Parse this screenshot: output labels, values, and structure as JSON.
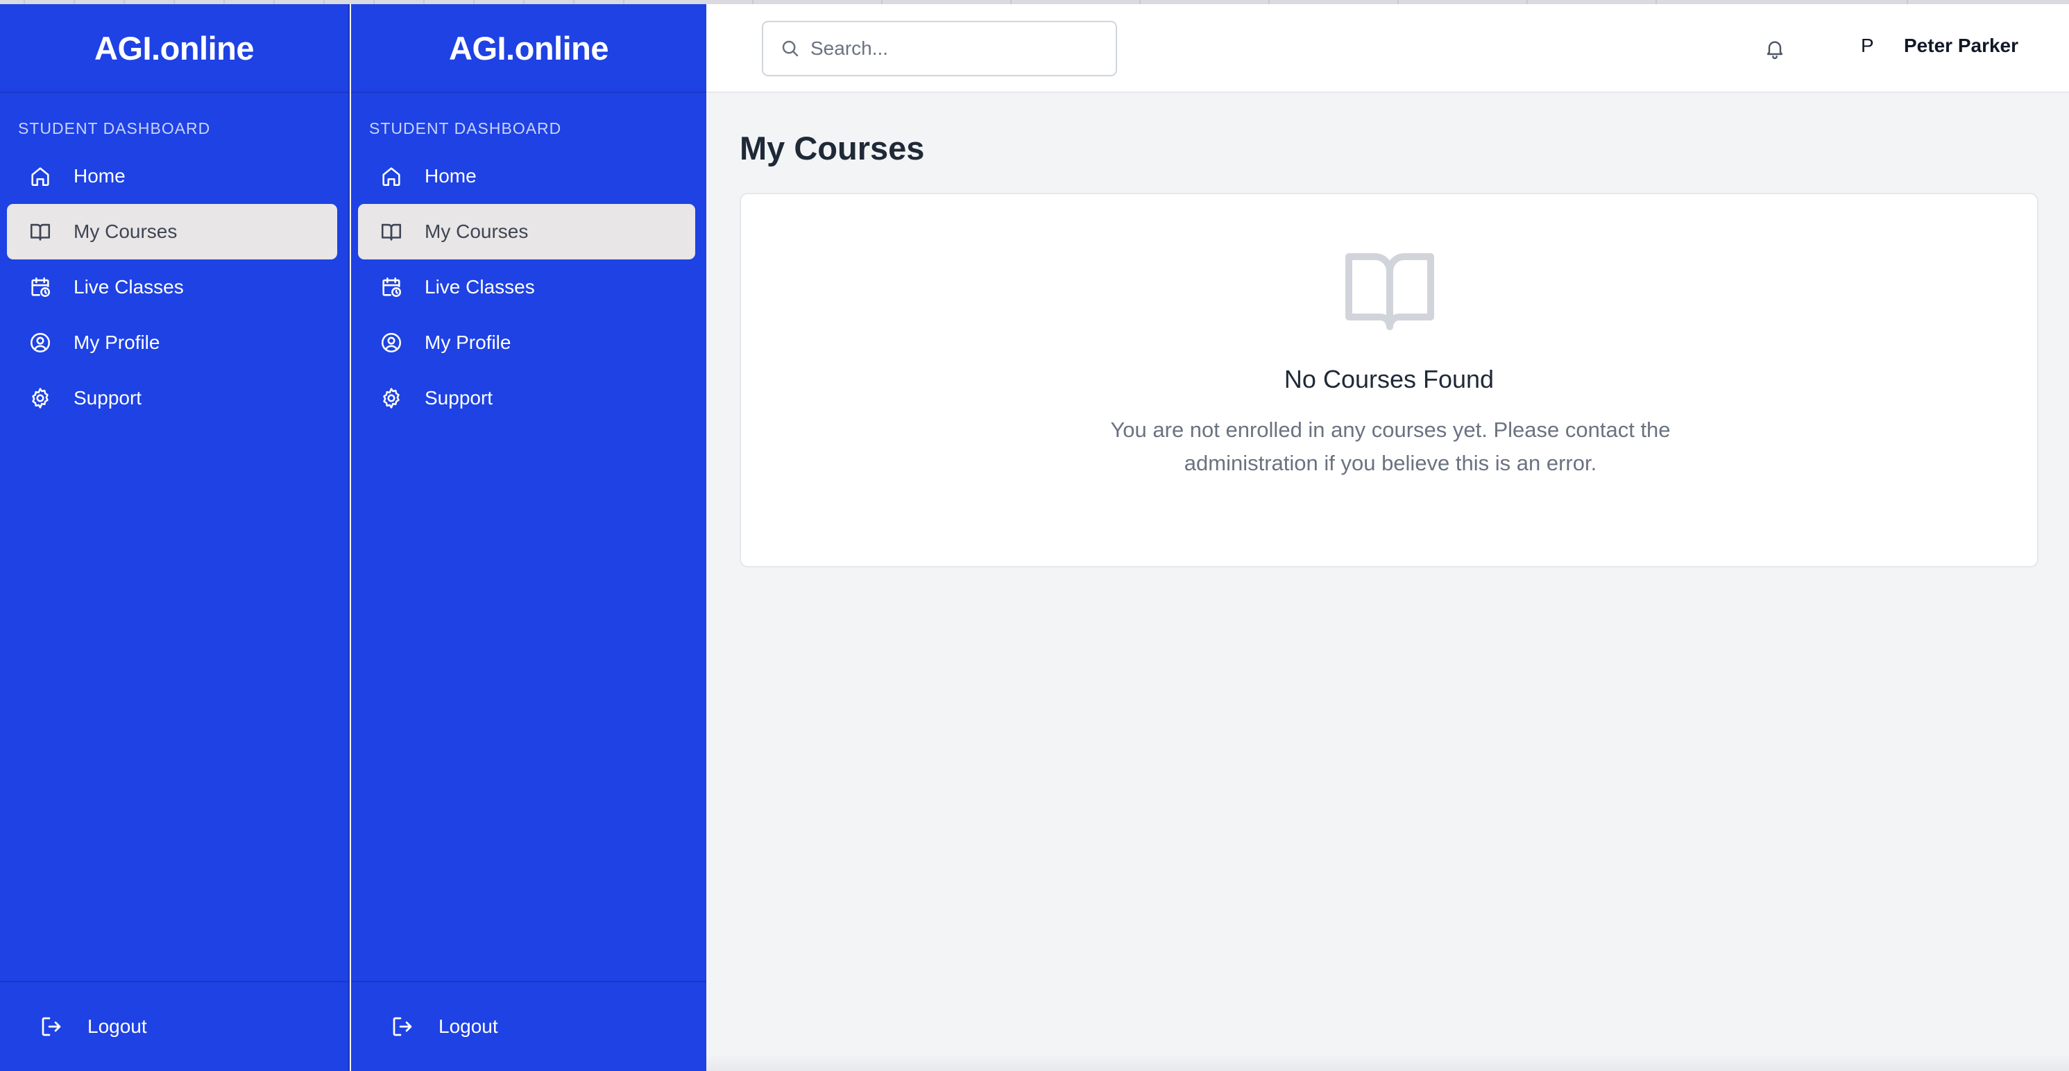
{
  "brand": "AGI.online",
  "sidebar": {
    "section_title": "STUDENT DASHBOARD",
    "items": [
      {
        "label": "Home",
        "icon": "home-icon",
        "active": false
      },
      {
        "label": "My Courses",
        "icon": "book-icon",
        "active": true
      },
      {
        "label": "Live Classes",
        "icon": "calendar-clock-icon",
        "active": false
      },
      {
        "label": "My Profile",
        "icon": "user-circle-icon",
        "active": false
      },
      {
        "label": "Support",
        "icon": "gear-icon",
        "active": false
      }
    ],
    "logout_label": "Logout"
  },
  "header": {
    "search_placeholder": "Search...",
    "avatar_initial": "P",
    "user_name": "Peter Parker"
  },
  "main": {
    "page_title": "My Courses",
    "empty_state": {
      "title": "No Courses Found",
      "message": "You are not enrolled in any courses yet. Please contact the administration if you believe this is an error."
    }
  },
  "colors": {
    "sidebar_bg": "#1e42e3",
    "active_item_bg": "#e8e6e6",
    "page_bg": "#f3f4f6"
  }
}
